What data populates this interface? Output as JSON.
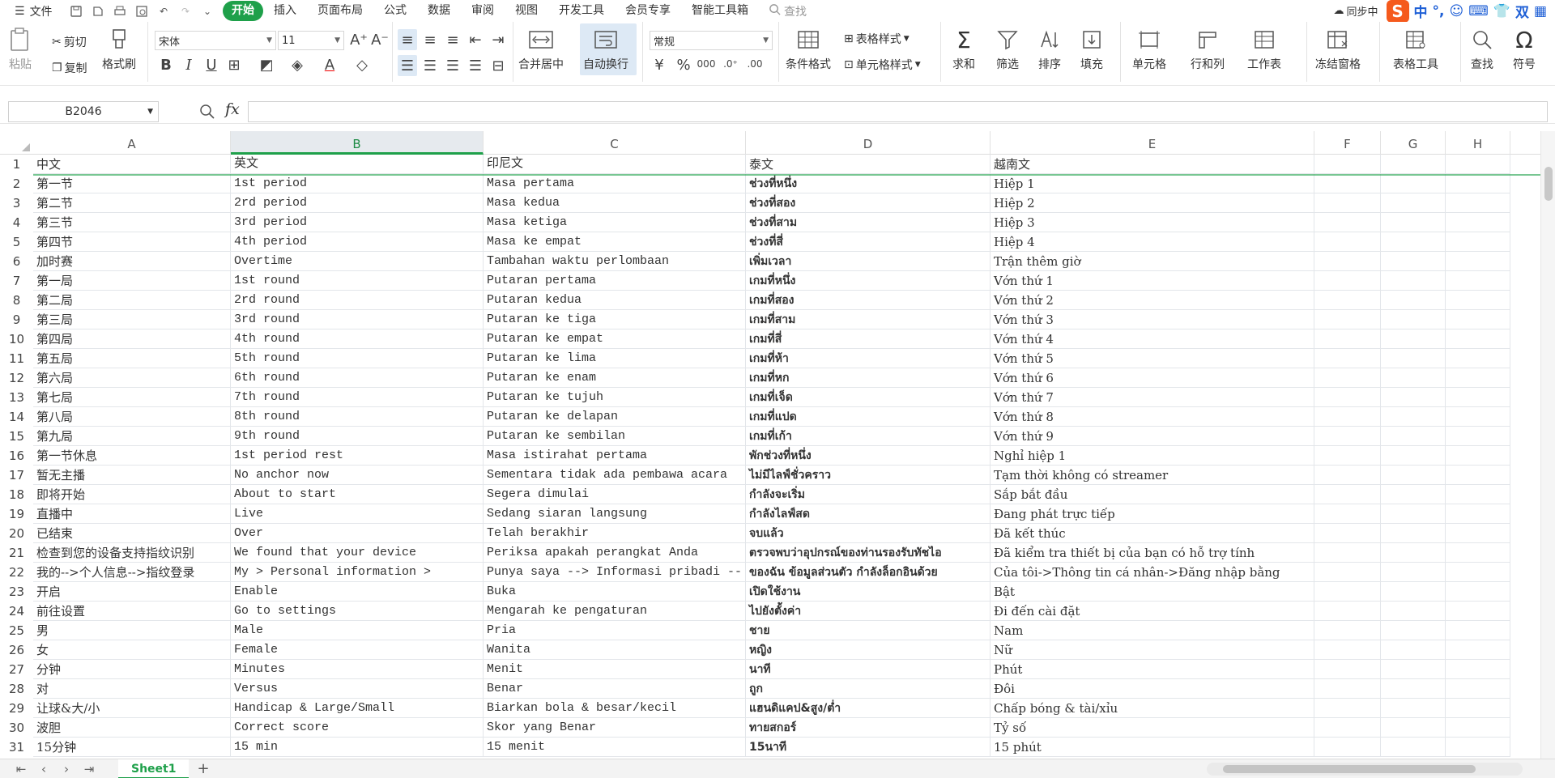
{
  "menu": {
    "file": "文件",
    "tabs": [
      "开始",
      "插入",
      "页面布局",
      "公式",
      "数据",
      "审阅",
      "视图",
      "开发工具",
      "会员专享",
      "智能工具箱"
    ],
    "search": "查找",
    "sync": "同步中",
    "ime": {
      "zh": "中",
      "punct": "°,",
      "shuang": "双"
    }
  },
  "ribbon": {
    "paste": "粘贴",
    "cut": "剪切",
    "copy": "复制",
    "format_painter": "格式刷",
    "font_name": "宋体",
    "font_size": "11",
    "merge_center": "合并居中",
    "wrap_text": "自动换行",
    "number_format": "常规",
    "conditional_format": "条件格式",
    "table_style": "表格样式",
    "cell_style": "单元格样式",
    "sum": "求和",
    "filter": "筛选",
    "sort": "排序",
    "fill": "填充",
    "cell": "单元格",
    "row_col": "行和列",
    "worksheet": "工作表",
    "freeze": "冻结窗格",
    "table_tools": "表格工具",
    "find": "查找",
    "symbol": "符号"
  },
  "formula_bar": {
    "name_box": "B2046",
    "fx": "fx",
    "formula": ""
  },
  "columns": [
    "A",
    "B",
    "C",
    "D",
    "E",
    "F",
    "G",
    "H"
  ],
  "rows": [
    [
      "中文",
      "英文",
      "印尼文",
      "泰文",
      "越南文"
    ],
    [
      "第一节",
      "1st period",
      "Masa pertama",
      "ช่วงที่หนึ่ง",
      "Hiệp 1"
    ],
    [
      "第二节",
      "2rd period",
      "Masa kedua",
      "ช่วงที่สอง",
      "Hiệp 2"
    ],
    [
      "第三节",
      "3rd period",
      "Masa ketiga",
      "ช่วงที่สาม",
      "Hiệp 3"
    ],
    [
      "第四节",
      "4th period",
      "Masa ke empat",
      "ช่วงที่สี่",
      "Hiệp 4"
    ],
    [
      "加时赛",
      "Overtime",
      "Tambahan waktu perlombaan",
      "เพิ่มเวลา",
      "Trận thêm giờ"
    ],
    [
      "第一局",
      "1st round",
      "Putaran pertama",
      "เกมที่หนึ่ง",
      "Vớn thứ 1"
    ],
    [
      "第二局",
      "2rd round",
      "Putaran kedua",
      "เกมที่สอง",
      "Vớn thứ 2"
    ],
    [
      "第三局",
      "3rd round",
      "Putaran ke tiga",
      "เกมที่สาม",
      "Vớn thứ 3"
    ],
    [
      "第四局",
      "4th round",
      "Putaran ke empat",
      "เกมที่สี่",
      "Vớn thứ 4"
    ],
    [
      "第五局",
      "5th round",
      "Putaran ke lima",
      "เกมที่ห้า",
      "Vớn thứ 5"
    ],
    [
      "第六局",
      "6th round",
      "Putaran ke enam",
      "เกมที่หก",
      "Vớn thứ 6"
    ],
    [
      "第七局",
      "7th round",
      "Putaran ke tujuh",
      "เกมที่เจ็ด",
      "Vớn thứ 7"
    ],
    [
      "第八局",
      "8th round",
      "Putaran ke delapan",
      "เกมที่แปด",
      "Vớn thứ 8"
    ],
    [
      "第九局",
      "9th round",
      "Putaran ke sembilan",
      "เกมที่เก้า",
      "Vớn thứ 9"
    ],
    [
      "第一节休息",
      "1st period rest",
      "Masa istirahat pertama",
      "พักช่วงที่หนึ่ง",
      "Nghỉ hiệp 1"
    ],
    [
      "暂无主播",
      "No anchor now",
      "Sementara tidak ada pembawa acara",
      "ไม่มีไลฟ์ชั่วคราว",
      "Tạm thời không có streamer"
    ],
    [
      "即将开始",
      "About to start",
      "Segera dimulai",
      "กำลังจะเริ่ม",
      "Sắp bắt đầu"
    ],
    [
      "直播中",
      "Live",
      "Sedang siaran langsung",
      "กำลังไลฟ์สด",
      "Đang phát trực tiếp"
    ],
    [
      "已结束",
      "Over",
      "Telah berakhir",
      "จบแล้ว",
      "Đã kết thúc"
    ],
    [
      "检查到您的设备支持指纹识别",
      "We found that your device",
      "Periksa apakah perangkat Anda",
      "ตรวจพบว่าอุปกรณ์ของท่านรองรับทัชไอ",
      "Đã kiểm tra thiết bị của bạn có hỗ trợ tính"
    ],
    [
      "我的-->个人信息-->指纹登录",
      "My > Personal information >",
      "Punya saya --> Informasi pribadi --",
      "ของฉัน ข้อมูลส่วนตัว กำลังล็อกอินด้วย",
      "Của tôi->Thông tin cá nhân->Đăng nhập bằng"
    ],
    [
      "开启",
      "Enable",
      "Buka",
      "เปิดใช้งาน",
      "Bật"
    ],
    [
      "前往设置",
      "Go to settings",
      "Mengarah ke pengaturan",
      "ไปยังตั้งค่า",
      "Đi đến cài đặt"
    ],
    [
      "男",
      "Male",
      "Pria",
      "ชาย",
      "Nam"
    ],
    [
      "女",
      "Female",
      "Wanita",
      "หญิง",
      "Nữ"
    ],
    [
      "分钟",
      "Minutes",
      "Menit",
      "นาที",
      "Phút"
    ],
    [
      "对",
      "Versus",
      "Benar",
      "ถูก",
      "Đôi"
    ],
    [
      "让球&大/小",
      "Handicap & Large/Small",
      "Biarkan bola & besar/kecil",
      "แฮนดิแคป&สูง/ต่ำ",
      "Chấp bóng & tài/xỉu"
    ],
    [
      "波胆",
      "Correct score",
      "Skor yang Benar",
      "ทายสกอร์",
      "Tỷ số"
    ],
    [
      "15分钟",
      "15 min",
      "15 menit",
      "15นาที",
      "15 phút"
    ]
  ],
  "sheet_tab": "Sheet1",
  "colors": {
    "accent": "#1ea04a",
    "selected_header_bg": "#e6eaee"
  }
}
